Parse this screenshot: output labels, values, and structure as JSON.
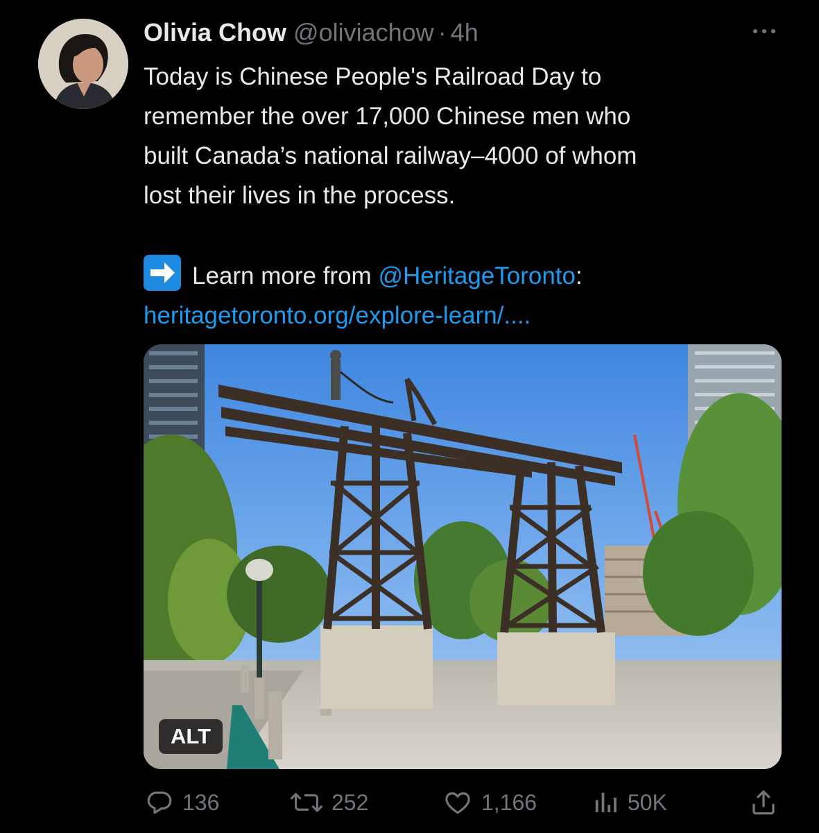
{
  "tweet": {
    "author_name": "Olivia Chow",
    "handle": "@oliviachow",
    "separator": "·",
    "time": "4h",
    "text_lines": [
      "Today is Chinese People's Railroad Day to",
      "remember the over 17,000 Chinese men who",
      "built Canada’s national railway–4000 of whom",
      "lost their lives in the process."
    ],
    "learn_prefix": "Learn more from ",
    "mention": "@HeritageToronto",
    "learn_suffix": ":",
    "url_text": "heritagetoronto.org/explore-learn/....",
    "emoji_icon": "right-arrow-emoji-icon",
    "media_alt_label": "ALT"
  },
  "actions": {
    "replies": "136",
    "reposts": "252",
    "likes": "1,166",
    "views": "50K"
  },
  "icons": {
    "more": "more-options-icon",
    "reply": "reply-icon",
    "repost": "repost-icon",
    "like": "heart-icon",
    "views": "views-chart-icon",
    "share": "share-icon"
  },
  "colors": {
    "background": "#000000",
    "text": "#e7e9ea",
    "muted": "#71767b",
    "link": "#1d9bf0"
  }
}
